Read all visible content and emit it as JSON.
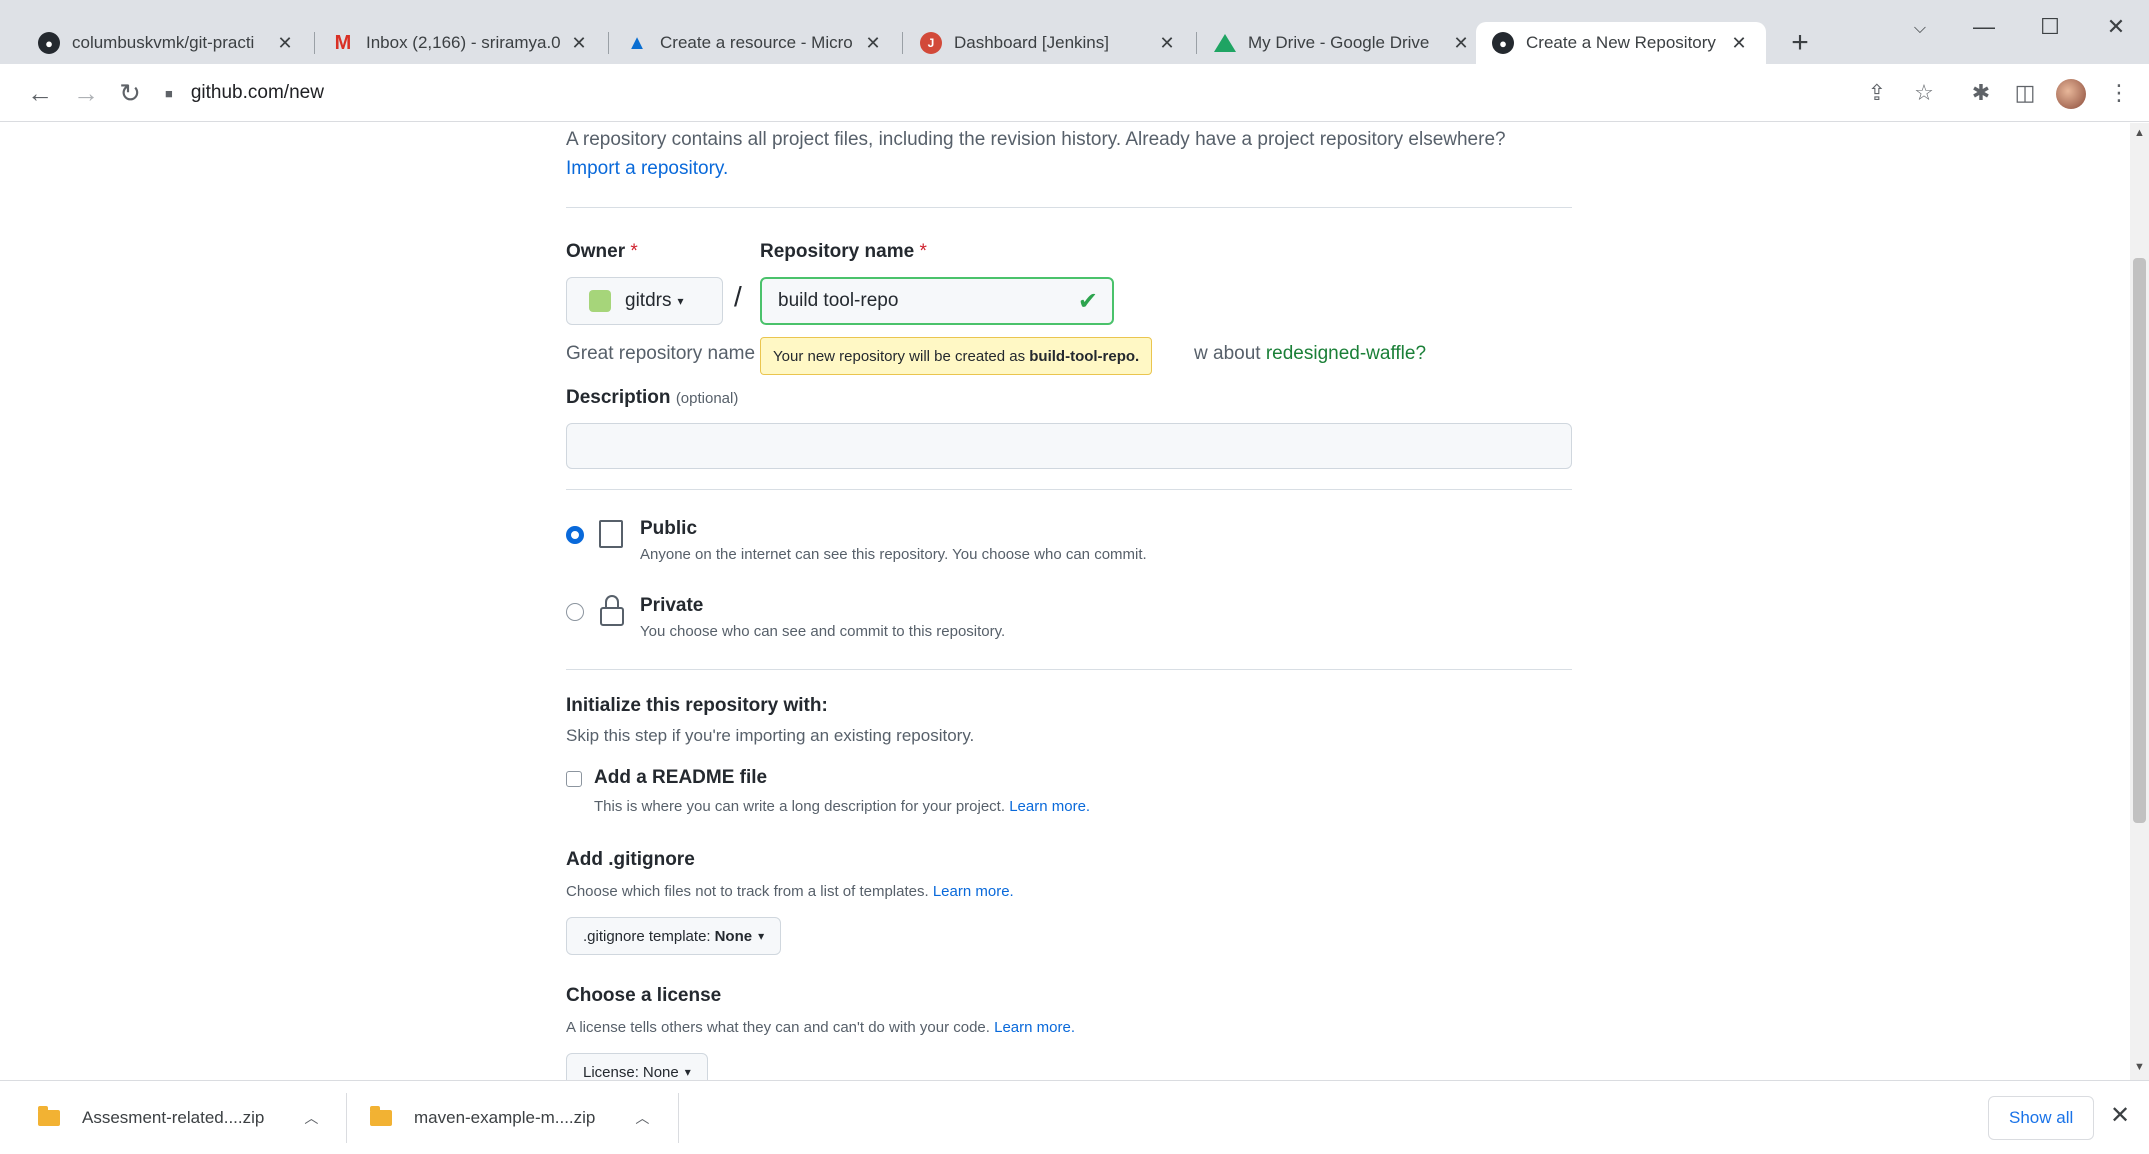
{
  "browser": {
    "tabs": [
      {
        "title": "columbuskvmk/git-practi",
        "icon": "github-icon"
      },
      {
        "title": "Inbox (2,166) - sriramya.0",
        "icon": "gmail-icon"
      },
      {
        "title": "Create a resource - Micro",
        "icon": "azure-icon"
      },
      {
        "title": "Dashboard [Jenkins]",
        "icon": "jenkins-icon"
      },
      {
        "title": "My Drive - Google Drive",
        "icon": "google-drive-icon"
      },
      {
        "title": "Create a New Repository",
        "icon": "github-icon"
      }
    ],
    "active_tab_index": 5,
    "close_glyph": "✕",
    "new_tab_glyph": "+",
    "url": "github.com/new"
  },
  "page": {
    "intro_text": "A repository contains all project files, including the revision history. Already have a project repository elsewhere?",
    "import_link": "Import a repository.",
    "owner_label": "Owner",
    "required_mark": "*",
    "repo_label": "Repository name",
    "owner_value": "gitdrs",
    "slash": "/",
    "repo_value": "build tool-repo",
    "hint_prefix": "Great repository name",
    "tooltip_prefix": "Your new repository will be created as",
    "tooltip_name": "build-tool-repo.",
    "hint_suffix_pre": "w about",
    "suggestion_link": "redesigned-waffle?",
    "description_label": "Description",
    "description_optional": "(optional)",
    "description_value": "",
    "visibility": {
      "selected": "Public",
      "public_title": "Public",
      "public_desc": "Anyone on the internet can see this repository. You choose who can commit.",
      "private_title": "Private",
      "private_desc": "You choose who can see and commit to this repository."
    },
    "init_title": "Initialize this repository with:",
    "init_sub": "Skip this step if you're importing an existing repository.",
    "readme_label": "Add a README file",
    "readme_checked": false,
    "readme_desc": "This is where you can write a long description for your project.",
    "learn_more": "Learn more.",
    "gitignore_title": "Add .gitignore",
    "gitignore_desc": "Choose which files not to track from a list of templates.",
    "gitignore_select_label": ".gitignore template:",
    "gitignore_select_value": "None",
    "license_title": "Choose a license",
    "license_desc": "A license tells others what they can and can't do with your code.",
    "license_select_label": "License:",
    "license_select_value": "None"
  },
  "downloads": {
    "items": [
      {
        "name": "Assesment-related....zip"
      },
      {
        "name": "maven-example-m....zip"
      }
    ],
    "show_all": "Show all"
  },
  "colors": {
    "link": "#0969da",
    "success": "#2da44e",
    "tooltip_bg": "#fff8c5"
  }
}
